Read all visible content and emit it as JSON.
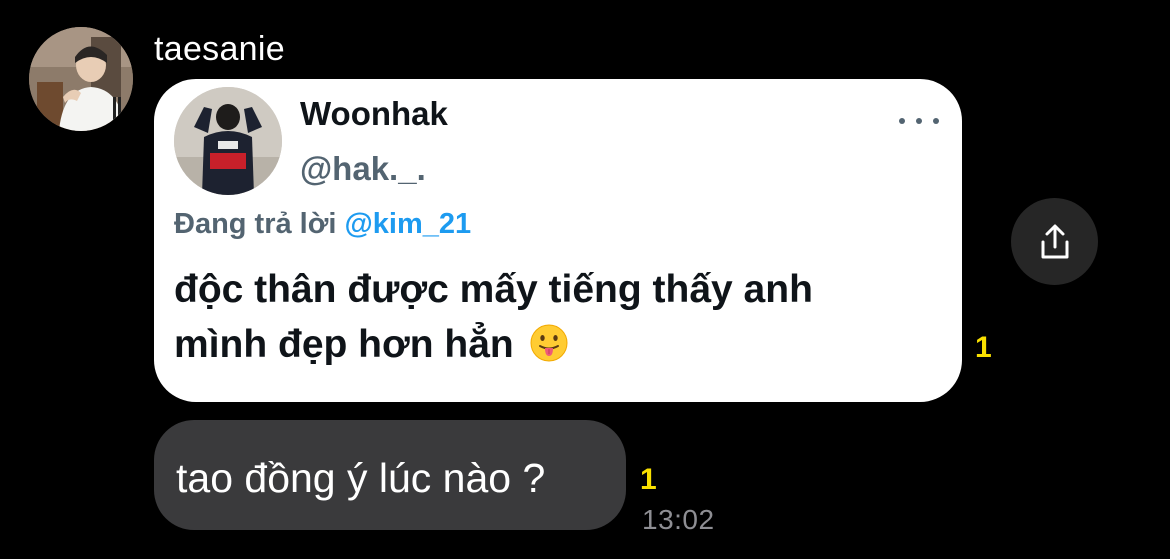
{
  "sender": {
    "name": "taesanie",
    "avatar_icon": "user-photo-avatar"
  },
  "tweet": {
    "display_name": "Woonhak",
    "handle": "@hak._.",
    "reply_prefix": "Đang trả lời",
    "reply_target": "@kim_21",
    "text_line1": "độc thân được mấy tiếng thấy anh",
    "text_line2": "mình đẹp hơn hẳn",
    "emoji": "tongue-out-emoji",
    "more_icon": "more-horizontal-icon",
    "read_count": "1"
  },
  "share": {
    "icon": "share-upload-icon"
  },
  "message": {
    "text": "tao đồng ý lúc nào ?",
    "read_count": "1",
    "timestamp": "13:02"
  },
  "colors": {
    "background": "#000000",
    "bubble": "#3a3a3c",
    "card": "#ffffff",
    "accent_blue": "#1d9bf0",
    "read_yellow": "#f9e000",
    "muted": "#536471"
  }
}
